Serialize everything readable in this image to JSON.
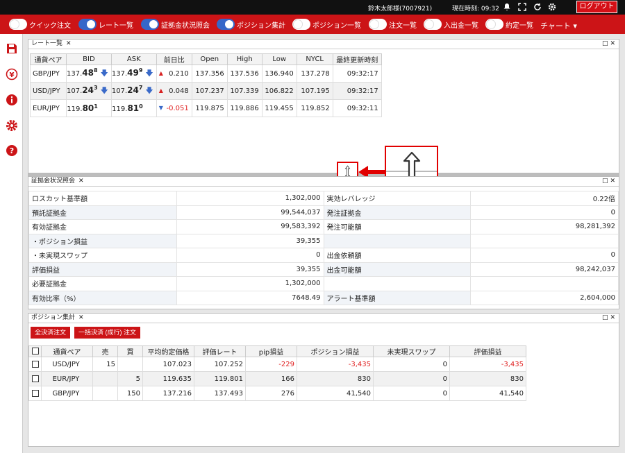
{
  "topbar": {
    "user": "鈴木太郎様(7007921)",
    "time": "現在時刻: 09:32",
    "logout": "ログアウト"
  },
  "toolbar": {
    "items": [
      {
        "label": "クイック注文",
        "on": false
      },
      {
        "label": "レート一覧",
        "on": true
      },
      {
        "label": "証拠金状況照会",
        "on": true
      },
      {
        "label": "ポジション集計",
        "on": true
      },
      {
        "label": "ポジション一覧",
        "on": false
      },
      {
        "label": "注文一覧",
        "on": false
      },
      {
        "label": "入出金一覧",
        "on": false
      },
      {
        "label": "約定一覧",
        "on": false
      }
    ],
    "chart": "チャート"
  },
  "rate_panel": {
    "title": "レート一覧",
    "headers": [
      "通貨ペア",
      "BID",
      "ASK",
      "前日比",
      "Open",
      "High",
      "Low",
      "NYCL",
      "最終更新時刻"
    ],
    "rows": [
      {
        "pair": "GBP/JPY",
        "bid_a": "137.",
        "bid_b": "48",
        "bid_c": "8",
        "ask_a": "137.",
        "ask_b": "49",
        "ask_c": "9",
        "change": "0.210",
        "dir": "up",
        "open": "137.356",
        "high": "137.536",
        "low": "136.940",
        "nycl": "137.278",
        "time": "09:32:17"
      },
      {
        "pair": "USD/JPY",
        "bid_a": "107.",
        "bid_b": "24",
        "bid_c": "3",
        "ask_a": "107.",
        "ask_b": "24",
        "ask_c": "7",
        "change": "0.048",
        "dir": "up",
        "open": "107.237",
        "high": "107.339",
        "low": "106.822",
        "nycl": "107.195",
        "time": "09:32:17"
      },
      {
        "pair": "EUR/JPY",
        "bid_a": "119.",
        "bid_b": "80",
        "bid_c": "1",
        "ask_a": "119.",
        "ask_b": "81",
        "ask_c": "0",
        "change": "-0.051",
        "dir": "down",
        "open": "119.875",
        "high": "119.886",
        "low": "119.455",
        "nycl": "119.852",
        "time": "09:32:11"
      }
    ]
  },
  "margin_panel": {
    "title": "証拠金状況照会",
    "rows": [
      [
        "ロスカット基準額",
        "1,302,000",
        "実効レバレッジ",
        "0.22倍"
      ],
      [
        "預託証拠金",
        "99,544,037",
        "発注証拠金",
        "0"
      ],
      [
        "有効証拠金",
        "99,583,392",
        "発注可能額",
        "98,281,392"
      ],
      [
        "・ポジション損益",
        "39,355",
        "",
        ""
      ],
      [
        "・未実現スワップ",
        "0",
        "出金依頼額",
        "0"
      ],
      [
        "評価損益",
        "39,355",
        "出金可能額",
        "98,242,037"
      ],
      [
        "必要証拠金",
        "1,302,000",
        "",
        ""
      ],
      [
        "有効比率（%）",
        "7648.49",
        "アラート基準額",
        "2,604,000"
      ]
    ]
  },
  "position_panel": {
    "title": "ポジション集計",
    "btn_all": "全決済注文",
    "btn_bulk": "一括決済 (成行) 注文",
    "headers": [
      "通貨ペア",
      "売",
      "買",
      "平均約定価格",
      "評価レート",
      "pip損益",
      "ポジション損益",
      "未実現スワップ",
      "評価損益"
    ],
    "rows": [
      {
        "pair": "USD/JPY",
        "sell": "15",
        "buy": "",
        "avg": "107.023",
        "rate": "107.252",
        "pip": "-229",
        "pl": "-3,435",
        "swap": "0",
        "eval": "-3,435",
        "neg": true
      },
      {
        "pair": "EUR/JPY",
        "sell": "",
        "buy": "5",
        "avg": "119.635",
        "rate": "119.801",
        "pip": "166",
        "pl": "830",
        "swap": "0",
        "eval": "830",
        "neg": false
      },
      {
        "pair": "GBP/JPY",
        "sell": "",
        "buy": "150",
        "avg": "137.216",
        "rate": "137.493",
        "pip": "276",
        "pl": "41,540",
        "swap": "0",
        "eval": "41,540",
        "neg": false
      }
    ]
  },
  "colors": {
    "brand": "#cc1417",
    "toggle_on": "#3567c9",
    "topbar": "#111111"
  }
}
